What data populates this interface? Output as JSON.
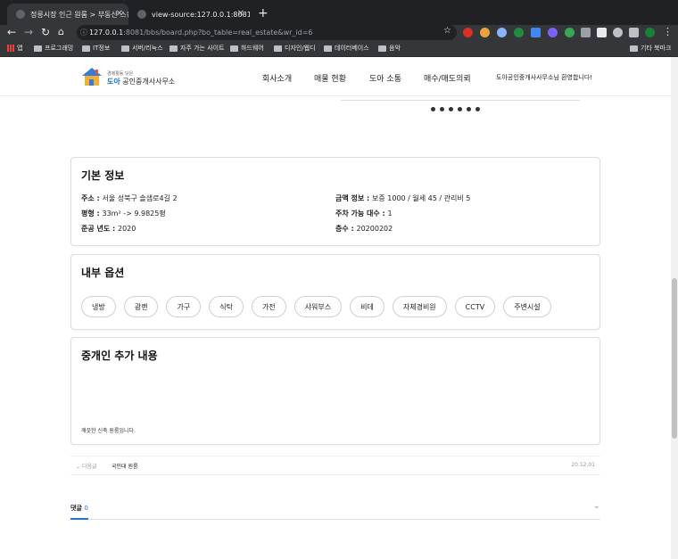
{
  "browser": {
    "tabs": [
      {
        "title": "정릉시장 인근 원룸 > 부동산 스킨 | ...",
        "active": true
      },
      {
        "title": "view-source:127.0.0.1:8081/bb...",
        "active": false
      }
    ],
    "url_host": "127.0.0.1",
    "url_rest": ":8081/bbs/board.php?bo_table=real_estate&wr_id=6",
    "bookmarks": [
      "앱",
      "프로그래밍",
      "IT정보",
      "서버/리눅스",
      "자주 가는 사이트",
      "하드웨어",
      "디자인/웹디",
      "데이터베이스",
      "음악"
    ],
    "other_bookmarks": "기타 북마크"
  },
  "site": {
    "logo_small": "경제활동 닷은",
    "logo_brand": "도아",
    "logo_name": "공인중개사사무소",
    "nav": [
      "회사소개",
      "매물 현황",
      "도아 소통",
      "매수/매도의뢰"
    ],
    "welcome": "도아공인중개사사무소님 환영합니다!"
  },
  "basic_info": {
    "title": "기본 정보",
    "address_label": "주소 : ",
    "address": "서울 성북구 솔샘로4길 2",
    "area_label": "평형 : ",
    "area": "33m² -> 9.9825평",
    "year_label": "준공 년도 : ",
    "year": "2020",
    "price_label": "금액 정보 : ",
    "price": "보증 1000 / 월세 45 / 관리비 5",
    "parking_label": "주차 가능 대수 : ",
    "parking": "1",
    "floor_label": "층수 : ",
    "floor": "20200202"
  },
  "options": {
    "title": "내부 옵션",
    "items": [
      "냉방",
      "광랜",
      "가구",
      "식탁",
      "가전",
      "샤워부스",
      "비데",
      "자체경비원",
      "CCTV",
      "주변시설"
    ]
  },
  "agent_notes": {
    "title": "중개인 추가 내용",
    "text": "깨끗한 신축 원룸입니다."
  },
  "next_post": {
    "label": "다음글",
    "title": "국민대 원룸",
    "date": "20.12.01"
  },
  "comments": {
    "label": "댓글",
    "count": "0"
  }
}
